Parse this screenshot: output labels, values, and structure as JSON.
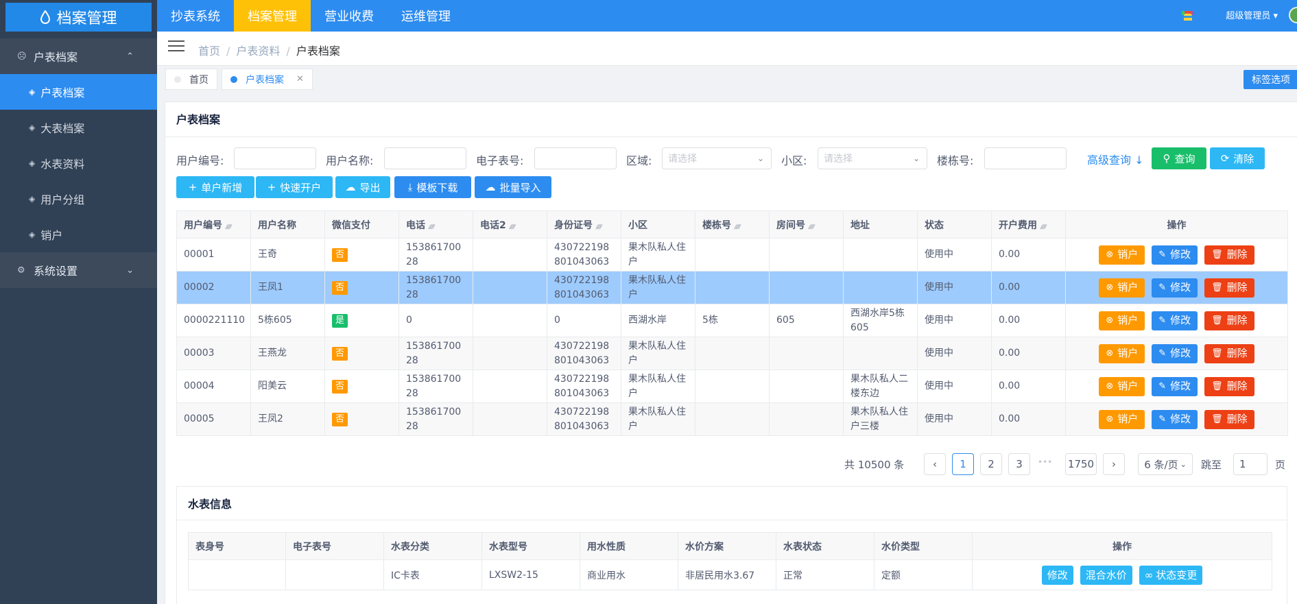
{
  "app": {
    "title": "档案管理"
  },
  "topnav": [
    "抄表系统",
    "档案管理",
    "营业收费",
    "运维管理"
  ],
  "user": {
    "name": "超级管理员"
  },
  "sidebar": {
    "parent1": "户表档案",
    "items": [
      "户表档案",
      "大表档案",
      "水表资料",
      "用户分组",
      "销户"
    ],
    "parent2": "系统设置"
  },
  "breadcrumb": [
    "首页",
    "户表资料",
    "户表档案"
  ],
  "tags": [
    "首页",
    "户表档案"
  ],
  "tag_options": "标签选项",
  "card_title": "户表档案",
  "filters": {
    "user_no": "用户编号:",
    "user_name": "用户名称:",
    "meter_no": "电子表号:",
    "area": "区域:",
    "area_ph": "请选择",
    "community": "小区:",
    "community_ph": "请选择",
    "building": "楼栋号:",
    "advanced": "高级查询"
  },
  "buttons": {
    "query": "查询",
    "clear": "清除",
    "add": "单户新增",
    "quick": "快速开户",
    "export": "导出",
    "template": "模板下载",
    "import": "批量导入"
  },
  "columns": [
    "用户编号",
    "用户名称",
    "微信支付",
    "电话",
    "电话2",
    "身份证号",
    "小区",
    "楼栋号",
    "房间号",
    "地址",
    "状态",
    "开户费用",
    "操作"
  ],
  "rows": [
    [
      "00001",
      "王奇",
      "否",
      "15386170028",
      "",
      "430722198801043063",
      "果木队私人住户",
      "",
      "",
      "",
      "使用中",
      "0.00"
    ],
    [
      "00002",
      "王凤1",
      "否",
      "15386170028",
      "",
      "430722198801043063",
      "果木队私人住户",
      "",
      "",
      "",
      "使用中",
      "0.00"
    ],
    [
      "0000221110",
      "5栋605",
      "是",
      "0",
      "",
      "0",
      "西湖水岸",
      "5栋",
      "605",
      "西湖水岸5栋605",
      "使用中",
      "0.00"
    ],
    [
      "00003",
      "王燕龙",
      "否",
      "15386170028",
      "",
      "430722198801043063",
      "果木队私人住户",
      "",
      "",
      "",
      "使用中",
      "0.00"
    ],
    [
      "00004",
      "阳美云",
      "否",
      "15386170028",
      "",
      "430722198801043063",
      "果木队私人住户",
      "",
      "",
      "果木队私人二楼东边",
      "使用中",
      "0.00"
    ],
    [
      "00005",
      "王凤2",
      "否",
      "15386170028",
      "",
      "430722198801043063",
      "果木队私人住户",
      "",
      "",
      "果木队私人住户三楼",
      "使用中",
      "0.00"
    ]
  ],
  "row_ops": [
    "销户",
    "修改",
    "删除"
  ],
  "pagination": {
    "total": "共 10500 条",
    "pages": [
      "1",
      "2",
      "3",
      "1750"
    ],
    "ellipsis": "•••",
    "size": "6 条/页",
    "jump": "跳至",
    "jump_value": "1",
    "page_unit": "页"
  },
  "sub": {
    "title": "水表信息",
    "columns": [
      "表身号",
      "电子表号",
      "水表分类",
      "水表型号",
      "用水性质",
      "水价方案",
      "水表状态",
      "水价类型",
      "操作"
    ],
    "row": [
      "",
      "",
      "IC卡表",
      "LXSW2-15",
      "商业用水",
      "非居民用水3.67",
      "正常",
      "定额"
    ],
    "ops": [
      "修改",
      "混合水价",
      "状态变更"
    ]
  }
}
